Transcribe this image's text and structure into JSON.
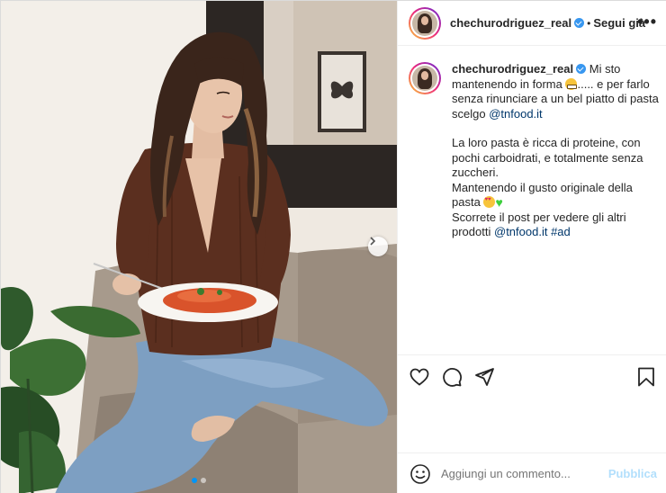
{
  "post": {
    "username": "chechurodriguez_real",
    "separator": "•",
    "follow_label": "Segui già",
    "more_label": "•••"
  },
  "caption": {
    "username": "chechurodriguez_real",
    "line1": "Mi sto mantenendo in forma",
    "line1_rest": "..... e per farlo senza rinunciare a un bel piatto di pasta scelgo",
    "mention1": "@tnfood.it",
    "para2": "La loro pasta è ricca di proteine, con pochi carboidrati, e totalmente senza zuccheri.",
    "para3": "Mantenendo il gusto originale della pasta",
    "para4": "Scorrete il post per vedere gli altri prodotti",
    "mention2": "@tnfood.it",
    "hashtag": "#ad"
  },
  "actions": {
    "like_icon": "heart-outline-icon",
    "comment_icon": "comment-bubble-icon",
    "share_icon": "paper-plane-icon",
    "save_icon": "bookmark-icon"
  },
  "comment_bar": {
    "emoji_icon": "smiley-icon",
    "placeholder": "Aggiungi un commento...",
    "publish_label": "Pubblica"
  },
  "carousel": {
    "slide_count": 2,
    "active_index": 0
  },
  "colors": {
    "link": "#00376b",
    "publish_disabled": "#b2dffc",
    "active_dot": "#0095f6",
    "verified": "#3897f0"
  }
}
